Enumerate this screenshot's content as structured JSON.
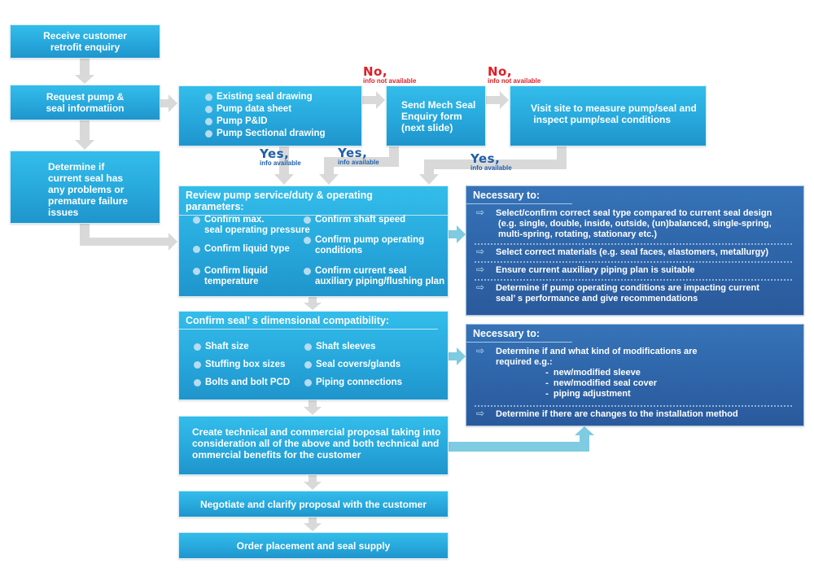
{
  "colors": {
    "process_box": "#29abe0",
    "detail_box": "#2e64a8",
    "gray_arrow": "#d9d9d9",
    "cyan_arrow": "#7ecbe2",
    "no_label": "#e01e25",
    "yes_label": "#1f5fa8"
  },
  "steps": {
    "receive": "Receive customer\nretrofit enquiry",
    "request": "Request pump &\nseal informatiion",
    "determine": "Determine if\ncurrent seal has\nany problems or\npremature failure\nissues",
    "send_form": "Send Mech Seal\nEnquiry form\n(next slide)",
    "visit_site": "Visit site to measure pump/seal and\n inspect pump/seal conditions",
    "proposal": "Create technical and commercial proposal taking into\nconsideration all of the above and both technical and\nommercial benefits for the customer",
    "negotiate": "Negotiate and clarify proposal with the customer",
    "order": "Order placement and seal supply"
  },
  "info_items": [
    "Existing seal drawing",
    "Pump data sheet",
    "Pump P&ID",
    "Pump Sectional drawing"
  ],
  "labels": {
    "no_big": "No,",
    "no_small": "info not available",
    "yes_big": "Yes,",
    "yes_small": "info available"
  },
  "review": {
    "title": "Review pump service/duty & operating parameters:",
    "left": [
      "Confirm max.\nseal operating pressure",
      "Confirm liquid type",
      "Confirm liquid\ntemperature"
    ],
    "right": [
      "Confirm shaft speed",
      "Confirm pump operating\nconditions",
      "Confirm current seal\nauxiliary piping/flushing plan"
    ]
  },
  "dimensional": {
    "title": "Confirm seal’ s dimensional compatibility:",
    "left": [
      "Shaft size",
      "Stuffing box sizes",
      "Bolts and bolt PCD"
    ],
    "right": [
      "Shaft sleeves",
      "Seal covers/glands",
      "Piping connections"
    ]
  },
  "necessary1": {
    "title": "Necessary to:",
    "items": [
      "Select/confirm correct seal type compared to current seal design\n (e.g. single, double, inside, outside, (un)balanced, single-spring,\n multi-spring, rotating, stationary etc.)",
      "Select correct materials (e.g. seal faces, elastomers, metallurgy)",
      "Ensure current auxiliary piping plan is suitable",
      "Determine if pump operating conditions are impacting current\nseal’ s performance and give recommendations"
    ]
  },
  "necessary2": {
    "title": "Necessary to:",
    "items": [
      "Determine if and what kind of modifications are\nrequired e.g.:\n                    -  new/modified sleeve\n                    -  new/modified seal cover\n                    -  piping adjustment",
      "Determine if there are changes to the installation method"
    ]
  },
  "icons": {
    "arrow_bullet": "⇨",
    "bullet": "●"
  }
}
